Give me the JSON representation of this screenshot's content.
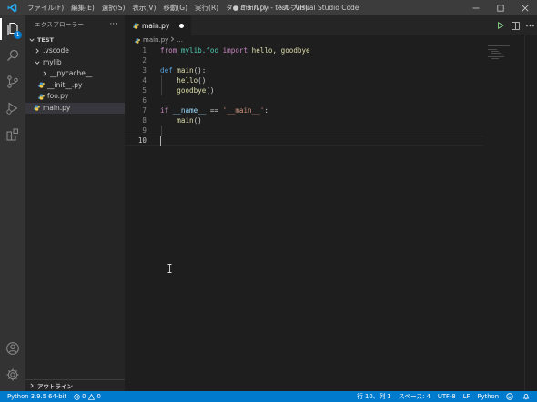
{
  "window": {
    "title": "● main.py - test - Visual Studio Code"
  },
  "menu": [
    "ファイル(F)",
    "編集(E)",
    "選択(S)",
    "表示(V)",
    "移動(G)",
    "実行(R)",
    "ターミナル(T)",
    "ヘルプ(H)"
  ],
  "activity_bar": {
    "explorer_badge": "1"
  },
  "sidebar": {
    "header": "エクスプローラー",
    "more": "···",
    "workspace": "TEST",
    "items": [
      {
        "label": ".vscode",
        "kind": "folder-collapsed"
      },
      {
        "label": "mylib",
        "kind": "folder-expanded"
      },
      {
        "label": "__pycache__",
        "kind": "folder-collapsed"
      },
      {
        "label": "__init__.py",
        "kind": "python-file"
      },
      {
        "label": "foo.py",
        "kind": "python-file"
      },
      {
        "label": "main.py",
        "kind": "python-file",
        "selected": true
      }
    ],
    "outline": "アウトライン"
  },
  "editor": {
    "tab_label": "main.py",
    "breadcrumb": {
      "file": "main.py",
      "rest": "..."
    },
    "line_numbers": [
      "1",
      "2",
      "3",
      "4",
      "5",
      "6",
      "7",
      "8",
      "9",
      "10"
    ],
    "code": {
      "l1": {
        "kw1": "from",
        "module": "mylib.foo",
        "kw2": "import",
        "names": "hello, goodbye"
      },
      "l3": {
        "kw": "def",
        "fn": "main",
        "rest": "():"
      },
      "l4": {
        "fn": "hello",
        "rest": "()"
      },
      "l5": {
        "fn": "goodbye",
        "rest": "()"
      },
      "l7": {
        "kw": "if",
        "var": "__name__",
        "op": "==",
        "str": "'__main__'",
        "colon": ":"
      },
      "l8": {
        "fn": "main",
        "rest": "()"
      }
    }
  },
  "statusbar": {
    "interpreter": "Python 3.9.5 64-bit",
    "errors": "0",
    "warnings": "0",
    "position": "行 10、列 1",
    "spaces": "スペース: 4",
    "encoding": "UTF-8",
    "eol": "LF",
    "language": "Python"
  },
  "colors": {
    "accent": "#007acc",
    "keyword_control": "#c586c0",
    "keyword": "#569cd6",
    "function": "#dcdcaa",
    "string": "#ce9178"
  }
}
